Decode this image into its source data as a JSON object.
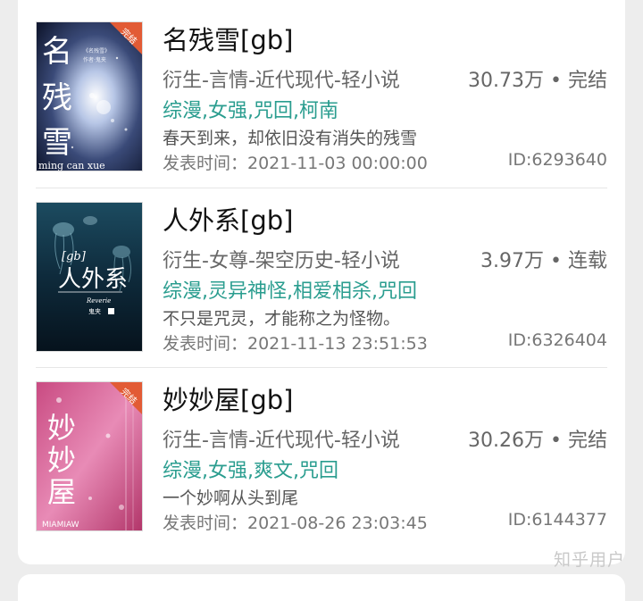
{
  "books": [
    {
      "title": "名残雪[gb]",
      "category": "衍生-言情-近代现代-轻小说",
      "stats": "30.73万 • 完结",
      "tags": "综漫,女强,咒回,柯南",
      "summary": "春天到来，却依旧没有消失的残雪",
      "date": "发表时间：2021-11-03 00:00:00",
      "id": "ID:6293640",
      "cover": {
        "badge": "完结",
        "title_chars": "名残雪",
        "subtitle": "ming can xue",
        "small_text": "《名残雪》作者·鬼夹",
        "colors": [
          "#1c2440",
          "#6f7fa6",
          "#e8edf7"
        ]
      }
    },
    {
      "title": "人外系[gb]",
      "category": "衍生-女尊-架空历史-轻小说",
      "stats": "3.97万 • 连载",
      "tags": "综漫,灵异神怪,相爱相杀,咒回",
      "summary": "不只是咒灵，才能称之为怪物。",
      "date": "发表时间：2021-11-13 23:51:53",
      "id": "ID:6326404",
      "cover": {
        "badge": "",
        "title_chars": "人外系",
        "prefix": "[gb]",
        "small_text": "鬼夹",
        "colors": [
          "#081624",
          "#1f4e63",
          "#8fc2d0"
        ]
      }
    },
    {
      "title": "妙妙屋[gb]",
      "category": "衍生-言情-近代现代-轻小说",
      "stats": "30.26万 • 完结",
      "tags": "综漫,女强,爽文,咒回",
      "summary": "一个妙啊从头到尾",
      "date": "发表时间：2021-08-26 23:03:45",
      "id": "ID:6144377",
      "cover": {
        "badge": "完结",
        "title_chars": "妙妙屋",
        "subtitle": "MIAMIAW",
        "colors": [
          "#b9336e",
          "#e07fae",
          "#f7d6e6"
        ]
      }
    }
  ],
  "watermark": "知乎用户"
}
